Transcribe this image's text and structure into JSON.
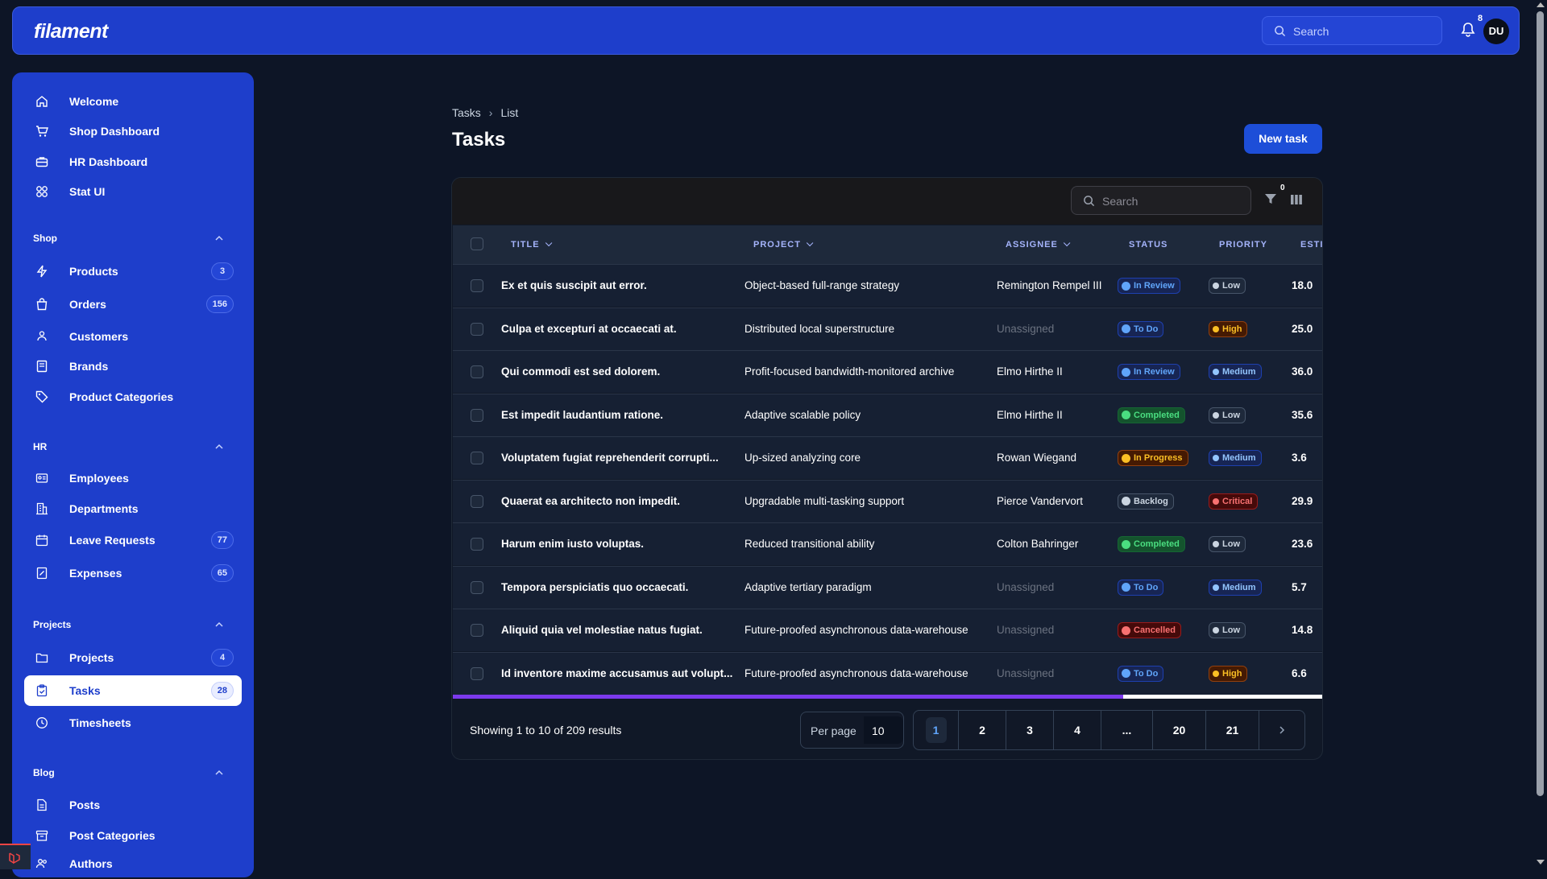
{
  "app": {
    "logo": "filament",
    "search_placeholder": "Search",
    "notification_count": "8",
    "user_initials": "DU"
  },
  "sidebar": {
    "top_items": [
      {
        "label": "Welcome",
        "icon": "home-icon"
      },
      {
        "label": "Shop Dashboard",
        "icon": "cart-icon"
      },
      {
        "label": "HR Dashboard",
        "icon": "briefcase-icon"
      },
      {
        "label": "Stat UI",
        "icon": "grid-icon"
      }
    ],
    "groups": {
      "shop": {
        "label": "Shop",
        "items": [
          {
            "label": "Products",
            "badge": "3"
          },
          {
            "label": "Orders",
            "badge": "156"
          },
          {
            "label": "Customers"
          },
          {
            "label": "Brands"
          },
          {
            "label": "Product Categories"
          }
        ]
      },
      "hr": {
        "label": "HR",
        "items": [
          {
            "label": "Employees"
          },
          {
            "label": "Departments"
          },
          {
            "label": "Leave Requests",
            "badge": "77"
          },
          {
            "label": "Expenses",
            "badge": "65"
          }
        ]
      },
      "projects": {
        "label": "Projects",
        "items": [
          {
            "label": "Projects",
            "badge": "4"
          },
          {
            "label": "Tasks",
            "badge": "28",
            "active": true
          },
          {
            "label": "Timesheets"
          }
        ]
      },
      "blog": {
        "label": "Blog",
        "items": [
          {
            "label": "Posts"
          },
          {
            "label": "Post Categories"
          },
          {
            "label": "Authors"
          }
        ]
      }
    }
  },
  "page": {
    "breadcrumb": [
      "Tasks",
      "List"
    ],
    "title": "Tasks",
    "new_button": "New task"
  },
  "table": {
    "search_placeholder": "Search",
    "filter_count": "0",
    "columns": [
      "TITLE",
      "PROJECT",
      "ASSIGNEE",
      "STATUS",
      "PRIORITY",
      "ESTI"
    ],
    "rows": [
      {
        "title": "Ex et quis suscipit aut error.",
        "project": "Object-based full-range strategy",
        "assignee": "Remington Rempel III",
        "status": "In Review",
        "priority": "Low",
        "estimate": "18.0"
      },
      {
        "title": "Culpa et excepturi at occaecati at.",
        "project": "Distributed local superstructure",
        "assignee": "Unassigned",
        "status": "To Do",
        "priority": "High",
        "estimate": "25.0"
      },
      {
        "title": "Qui commodi est sed dolorem.",
        "project": "Profit-focused bandwidth-monitored archive",
        "assignee": "Elmo Hirthe II",
        "status": "In Review",
        "priority": "Medium",
        "estimate": "36.0"
      },
      {
        "title": "Est impedit laudantium ratione.",
        "project": "Adaptive scalable policy",
        "assignee": "Elmo Hirthe II",
        "status": "Completed",
        "priority": "Low",
        "estimate": "35.6"
      },
      {
        "title": "Voluptatem fugiat reprehenderit corrupti...",
        "project": "Up-sized analyzing core",
        "assignee": "Rowan Wiegand",
        "status": "In Progress",
        "priority": "Medium",
        "estimate": "3.6"
      },
      {
        "title": "Quaerat ea architecto non impedit.",
        "project": "Upgradable multi-tasking support",
        "assignee": "Pierce Vandervort",
        "status": "Backlog",
        "priority": "Critical",
        "estimate": "29.9"
      },
      {
        "title": "Harum enim iusto voluptas.",
        "project": "Reduced transitional ability",
        "assignee": "Colton Bahringer",
        "status": "Completed",
        "priority": "Low",
        "estimate": "23.6"
      },
      {
        "title": "Tempora perspiciatis quo occaecati.",
        "project": "Adaptive tertiary paradigm",
        "assignee": "Unassigned",
        "status": "To Do",
        "priority": "Medium",
        "estimate": "5.7"
      },
      {
        "title": "Aliquid quia vel molestiae natus fugiat.",
        "project": "Future-proofed asynchronous data-warehouse",
        "assignee": "Unassigned",
        "status": "Cancelled",
        "priority": "Low",
        "estimate": "14.8"
      },
      {
        "title": "Id inventore maxime accusamus aut volupt...",
        "project": "Future-proofed asynchronous data-warehouse",
        "assignee": "Unassigned",
        "status": "To Do",
        "priority": "High",
        "estimate": "6.6"
      }
    ],
    "horizontal_scroll_fraction": 0.77,
    "footer": {
      "summary": "Showing 1 to 10 of 209 results",
      "per_page_label": "Per page",
      "per_page_value": "10",
      "pages": [
        "1",
        "2",
        "3",
        "4",
        "...",
        "20",
        "21"
      ],
      "current_page": "1"
    }
  },
  "colors": {
    "brand": "#1e3ecb",
    "status": {
      "In Review": {
        "fg": "#60a5fa",
        "bg": "#172554",
        "border": "#1e40af"
      },
      "To Do": {
        "fg": "#60a5fa",
        "bg": "#172554",
        "border": "#1e40af"
      },
      "Completed": {
        "fg": "#4ade80",
        "bg": "#14532d",
        "border": "#166534"
      },
      "In Progress": {
        "fg": "#fbbf24",
        "bg": "#451a03",
        "border": "#92400e"
      },
      "Backlog": {
        "fg": "#cbd5e1",
        "bg": "#1e293b",
        "border": "#475569"
      },
      "Cancelled": {
        "fg": "#f87171",
        "bg": "#450a0a",
        "border": "#991b1b"
      }
    },
    "priority": {
      "Low": {
        "fg": "#cbd5e1",
        "bg": "#1e293b",
        "border": "#475569"
      },
      "Medium": {
        "fg": "#93c5fd",
        "bg": "#172554",
        "border": "#1e40af"
      },
      "High": {
        "fg": "#fbbf24",
        "bg": "#451a03",
        "border": "#92400e"
      },
      "Critical": {
        "fg": "#f87171",
        "bg": "#450a0a",
        "border": "#991b1b"
      }
    }
  }
}
